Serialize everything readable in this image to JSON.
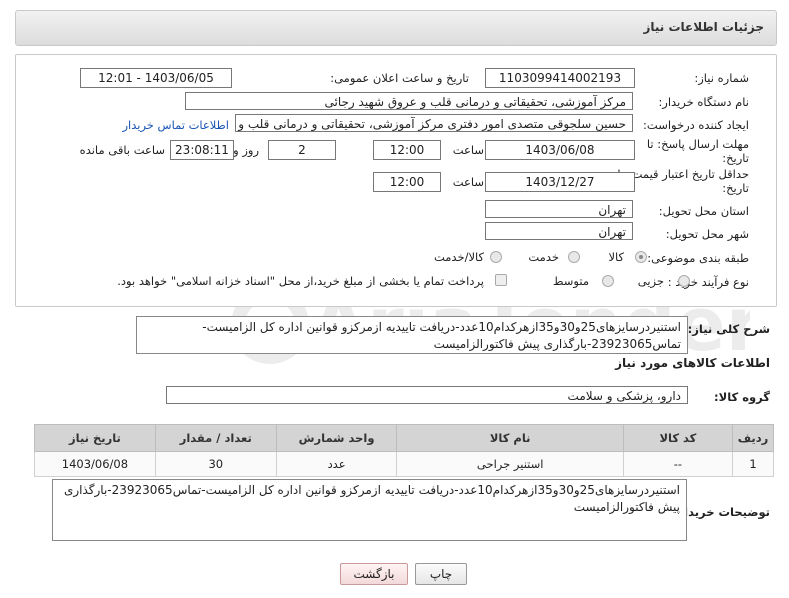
{
  "header": {
    "title": "جزئیات اطلاعات نیاز"
  },
  "fields": {
    "need_number_label": "شماره نیاز:",
    "need_number": "1103099414002193",
    "announce_label": "تاریخ و ساعت اعلان عمومی:",
    "announce_value": "1403/06/05 - 12:01",
    "buyer_org_label": "نام دستگاه خریدار:",
    "buyer_org": "مرکز آموزشی، تحقیقاتی و درمانی قلب و عروق شهید رجائی",
    "creator_label": "ایجاد کننده درخواست:",
    "creator": "حسین سلجوقی متصدی امور دفتری مرکز آموزشی، تحقیقاتی و درمانی قلب و ع",
    "contact_link": "اطلاعات تماس خریدار",
    "reply_deadline_label_1": "مهلت ارسال پاسخ: تا",
    "reply_deadline_label_2": "تاریخ:",
    "reply_date": "1403/06/08",
    "hour_label": "ساعت",
    "reply_time": "12:00",
    "days_value": "2",
    "days_and_label": "روز و",
    "remaining_time": "23:08:11",
    "remaining_label": "ساعت باقی مانده",
    "price_validity_label_1": "حداقل تاریخ اعتبار قیمت: تا",
    "price_validity_label_2": "تاریخ:",
    "price_date": "1403/12/27",
    "price_time": "12:00",
    "province_label": "استان محل تحویل:",
    "province": "تهران",
    "city_label": "شهر محل تحویل:",
    "city": "تهران",
    "category_label": "طبقه بندی موضوعی:",
    "cat_goods": "کالا",
    "cat_service": "خدمت",
    "cat_goods_service": "کالا/خدمت",
    "process_label": "نوع فرآیند خرید :",
    "proc_small": "جزیی",
    "proc_medium": "متوسط",
    "treasury_note": "پرداخت تمام یا بخشی از مبلغ خرید،از محل \"اسناد خزانه اسلامی\" خواهد بود."
  },
  "description": {
    "label": "شرح کلی نیاز:",
    "text": "استنیردرسایزهای25و30و35ازهرکدام10عدد-دریافت تاییدیه ازمرکزو قوانین اداره کل الزامیست-تماس23923065-بارگذاری پیش فاکتورالزامیست"
  },
  "goods_info_title": "اطلاعات کالاهای مورد نیاز",
  "goods_group": {
    "label": "گروه کالا:",
    "value": "دارو، پزشکی و سلامت"
  },
  "table": {
    "headers": [
      "ردیف",
      "کد کالا",
      "نام کالا",
      "واحد شمارش",
      "تعداد / مقدار",
      "تاریخ نیاز"
    ],
    "rows": [
      {
        "row": "1",
        "code": "--",
        "name": "استنیر جراحی",
        "unit": "عدد",
        "qty": "30",
        "date": "1403/06/08"
      }
    ]
  },
  "buyer_notes": {
    "label": "توضیحات خریدار:",
    "text": "استنیردرسایزهای25و30و35ازهرکدام10عدد-دریافت تاییدیه ازمرکزو قوانین اداره کل الزامیست-تماس23923065-بارگذاری پیش فاکتورالزامیست"
  },
  "buttons": {
    "print": "چاپ",
    "back": "بازگشت"
  },
  "watermark": "AriaTender.neT"
}
